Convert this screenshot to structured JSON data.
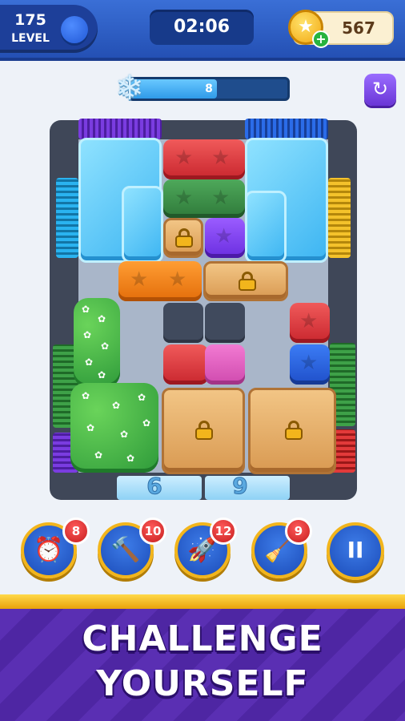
{
  "header": {
    "level_number": "175",
    "level_label": "LEVEL",
    "timer": "02:06",
    "coins": "567",
    "coin_plus": "+"
  },
  "freeze": {
    "value": "8",
    "fill_fraction": 0.55,
    "icon": "snowflake-icon"
  },
  "board": {
    "exit_numbers": [
      "6",
      "9"
    ]
  },
  "boosters": [
    {
      "name": "alarm-clock",
      "count": "8",
      "icon": "⏰"
    },
    {
      "name": "hammer",
      "count": "10",
      "icon": "🔨"
    },
    {
      "name": "rocket",
      "count": "12",
      "icon": "🚀"
    },
    {
      "name": "vacuum",
      "count": "9",
      "icon": "🧹"
    }
  ],
  "pause_label": "II",
  "banner": {
    "line1": "CHALLENGE",
    "line2": "YOURSELF"
  },
  "colors": {
    "header": "#2a5cc4",
    "banner": "#5a2fb3",
    "accent_gold": "#f2b51c"
  }
}
